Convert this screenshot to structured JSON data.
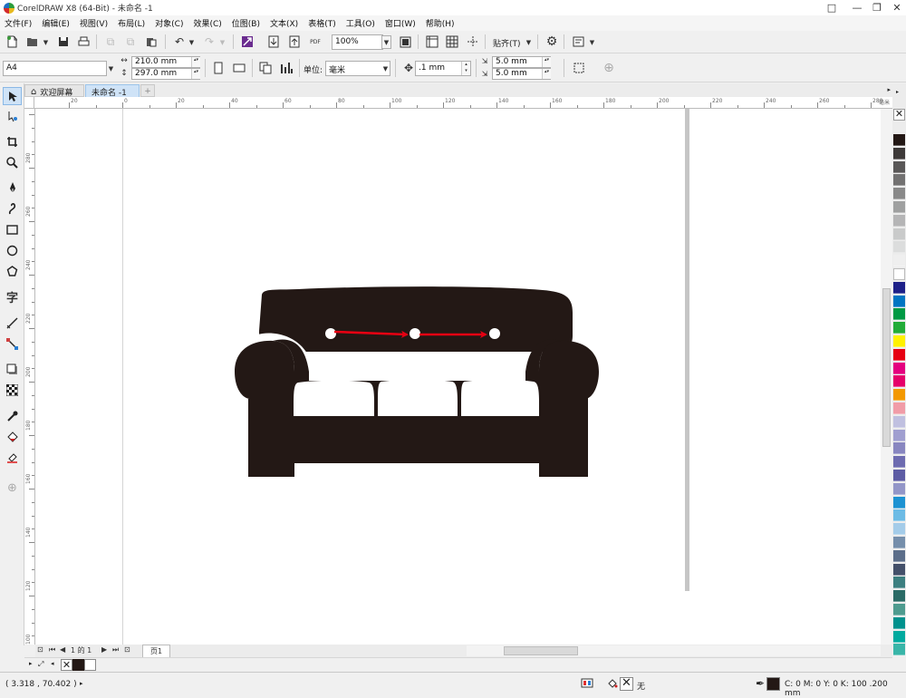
{
  "window": {
    "title": "CorelDRAW X8 (64-Bit) - 未命名 -1",
    "controls": [
      "□",
      "—",
      "❐",
      "✕"
    ]
  },
  "menu": [
    "文件(F)",
    "编辑(E)",
    "视图(V)",
    "布局(L)",
    "对象(C)",
    "效果(C)",
    "位图(B)",
    "文本(X)",
    "表格(T)",
    "工具(O)",
    "窗口(W)",
    "帮助(H)"
  ],
  "standard_toolbar": {
    "pdf_label": "PDF",
    "zoom": "100%",
    "snap_label": "贴齐(T)"
  },
  "property_bar": {
    "page_size": "A4",
    "width": "210.0 mm",
    "height": "297.0 mm",
    "unit_label": "单位:",
    "unit_value": "毫米",
    "nudge": ".1 mm",
    "dup_x": "5.0 mm",
    "dup_y": "5.0 mm"
  },
  "tabs": [
    {
      "label": "欢迎屏幕",
      "active": false
    },
    {
      "label": "未命名 -1",
      "active": true
    }
  ],
  "ruler": {
    "h_labels": [
      "20",
      "0",
      "20",
      "40",
      "60",
      "80",
      "100",
      "120",
      "140",
      "160",
      "180",
      "200",
      "220",
      "240",
      "260",
      "280",
      "毫米"
    ],
    "v_labels": [
      "280",
      "260",
      "240",
      "220",
      "200",
      "180",
      "160",
      "140",
      "120",
      "100",
      "80"
    ]
  },
  "tools": [
    "pick",
    "shape",
    "crop",
    "zoom",
    "freehand",
    "artistic-media",
    "rectangle",
    "ellipse",
    "polygon",
    "text",
    "parallel-dimension",
    "connector",
    "drop-shadow",
    "transparency",
    "eyedropper",
    "interactive-fill",
    "smart-fill",
    "add"
  ],
  "palette_colors": [
    "#231815",
    "#3e3a39",
    "#595757",
    "#727171",
    "#898989",
    "#9fa0a0",
    "#b5b5b6",
    "#c9caca",
    "#dcdddd",
    "#efefef",
    "#ffffff",
    "#1d2088",
    "#0075c2",
    "#009944",
    "#22ac38",
    "#fff100",
    "#e60012",
    "#e4007f",
    "#e5006a",
    "#f39800",
    "#f19ca7",
    "#c0c0e0",
    "#a09fd0",
    "#8886c0",
    "#6d6bb0",
    "#5d5ca4",
    "#9396c8",
    "#1c92d2",
    "#6cbbe5",
    "#a4cce9",
    "#758eab",
    "#5c6e8a",
    "#44506a",
    "#3c7f80",
    "#2a6b66",
    "#4e9b8f",
    "#00918d",
    "#00aa9f",
    "#39b5a8"
  ],
  "page_nav": {
    "page_of": "1 的 1",
    "page_tab": "页1"
  },
  "status": {
    "coords": "( 3.318 , 70.402 )",
    "fill_none": "无",
    "outline": "C: 0 M: 0 Y: 0 K: 100  .200 mm"
  },
  "colors": {
    "sofa": "#231815",
    "arrow": "#e60012"
  }
}
